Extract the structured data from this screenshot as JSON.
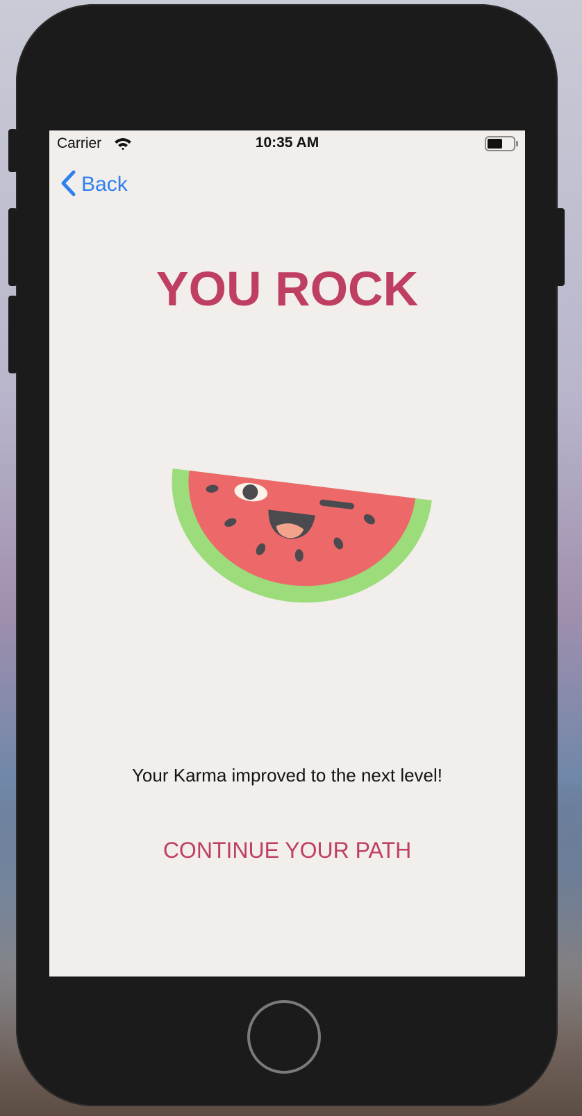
{
  "status_bar": {
    "carrier": "Carrier",
    "time": "10:35 AM",
    "wifi_icon": "wifi-icon",
    "battery_icon": "battery-icon"
  },
  "nav": {
    "back_label": "Back",
    "back_icon": "chevron-left-icon"
  },
  "main": {
    "title": "YOU ROCK",
    "illustration": "watermelon-illustration",
    "message": "Your Karma improved to the next level!",
    "continue_label": "CONTINUE YOUR PATH"
  },
  "colors": {
    "accent": "#bf3f62",
    "link": "#2f80ed",
    "screen_background": "#f1eeec",
    "watermelon_flesh": "#ec6869",
    "watermelon_rind": "#9cdc7a",
    "seeds": "#4a4a4f"
  },
  "device": {
    "home_button_icon": "home-button"
  }
}
